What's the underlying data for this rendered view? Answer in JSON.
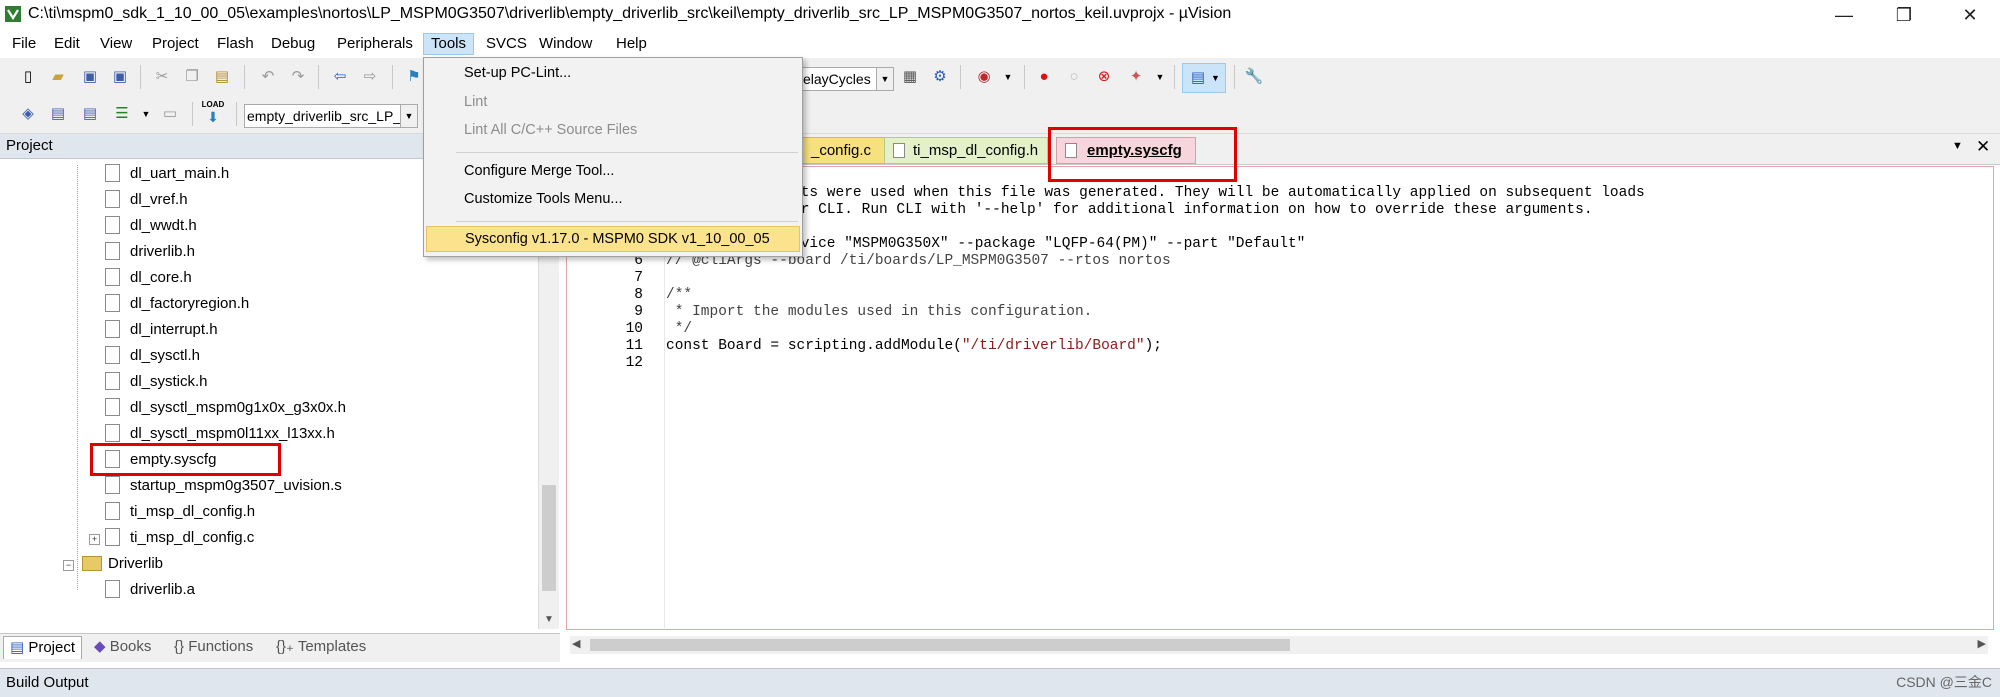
{
  "window": {
    "title": "C:\\ti\\mspm0_sdk_1_10_00_05\\examples\\nortos\\LP_MSPM0G3507\\driverlib\\empty_driverlib_src\\keil\\empty_driverlib_src_LP_MSPM0G3507_nortos_keil.uvprojx - µVision",
    "minimize": "—",
    "restore": "❐",
    "close": "✕"
  },
  "menubar": [
    "File",
    "Edit",
    "View",
    "Project",
    "Flash",
    "Debug",
    "Peripherals",
    "Tools",
    "SVCS",
    "Window",
    "Help"
  ],
  "toolbar": {
    "delay_combo": "elayCycles",
    "target_combo": "empty_driverlib_src_LP_M",
    "load_label": "LOAD"
  },
  "tools_menu": {
    "items": [
      {
        "label": "Set-up PC-Lint...",
        "enabled": true
      },
      {
        "label": "Lint",
        "enabled": false
      },
      {
        "label": "Lint All C/C++ Source Files",
        "enabled": false
      },
      {
        "label": "Configure Merge Tool...",
        "enabled": true
      },
      {
        "label": "Customize Tools Menu...",
        "enabled": true
      },
      {
        "label": "Sysconfig v1.17.0 - MSPM0 SDK v1_10_00_05",
        "enabled": true,
        "highlighted": true
      }
    ]
  },
  "project_pane": {
    "header": "Project",
    "files": [
      "dl_uart_main.h",
      "dl_vref.h",
      "dl_wwdt.h",
      "driverlib.h",
      "dl_core.h",
      "dl_factoryregion.h",
      "dl_interrupt.h",
      "dl_sysctl.h",
      "dl_systick.h",
      "dl_sysctl_mspm0g1x0x_g3x0x.h",
      "dl_sysctl_mspm0l11xx_l13xx.h",
      "empty.syscfg",
      "startup_mspm0g3507_uvision.s",
      "ti_msp_dl_config.h",
      "ti_msp_dl_config.c"
    ],
    "folder": "Driverlib",
    "folder_files": [
      "driverlib.a"
    ],
    "tabs": [
      "Project",
      "Books",
      "Functions",
      "Templates"
    ]
  },
  "editor": {
    "tabs": [
      "_config.c",
      "ti_msp_dl_config.h",
      "empty.syscfg"
    ],
    "active_tab": "empty.syscfg",
    "lines": [
      {
        "n": "",
        "text": "nts were used when this file was generated. They will be automatically applied on subsequent loads"
      },
      {
        "n": "",
        "text": "or CLI. Run CLI with '--help' for additional information on how to override these arguments."
      },
      {
        "n": "",
        "text": ""
      },
      {
        "n": "",
        "text": "evice \"MSPM0G350X\" --package \"LQFP-64(PM)\" --part \"Default\""
      },
      {
        "n": "6",
        "text": "// @cliArgs --board /ti/boards/LP_MSPM0G3507 --rtos nortos"
      },
      {
        "n": "7",
        "text": ""
      },
      {
        "n": "8",
        "text": "/**"
      },
      {
        "n": "9",
        "text": " * Import the modules used in this configuration."
      },
      {
        "n": "10",
        "text": " */"
      },
      {
        "n": "11",
        "text_pre": "const Board = scripting.addModule(",
        "text_str": "\"/ti/driverlib/Board\"",
        "text_post": ");"
      },
      {
        "n": "12",
        "text": ""
      }
    ]
  },
  "build_output": "Build Output",
  "watermark": "CSDN @三金C"
}
